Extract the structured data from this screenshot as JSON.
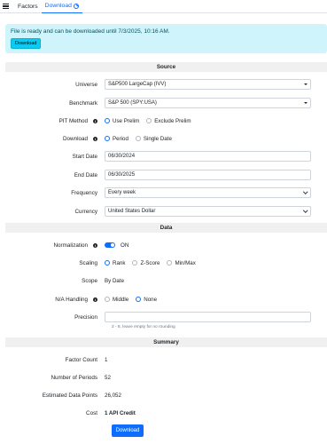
{
  "tabs": [
    {
      "label": "Factors"
    },
    {
      "label": "Download"
    }
  ],
  "alert": {
    "message": "File is ready and can be downloaded until 7/3/2025, 10:16 AM.",
    "button": "Download"
  },
  "sections": {
    "source": "Source",
    "data": "Data",
    "summary": "Summary"
  },
  "source": {
    "universe": {
      "label": "Universe",
      "value": "S&P500 LargeCap (IVV)"
    },
    "benchmark": {
      "label": "Benchmark",
      "value": "S&P 500 (SPY:USA)"
    },
    "pit_method": {
      "label": "PIT Method",
      "options": [
        "Use Prelim",
        "Exclude Prelim"
      ],
      "selected": "Use Prelim"
    },
    "download": {
      "label": "Download",
      "options": [
        "Period",
        "Single Date"
      ],
      "selected": "Period"
    },
    "start_date": {
      "label": "Start Date",
      "value": "06/30/2024"
    },
    "end_date": {
      "label": "End Date",
      "value": "06/30/2025"
    },
    "frequency": {
      "label": "Frequency",
      "value": "Every week"
    },
    "currency": {
      "label": "Currency",
      "value": "United States Dollar"
    }
  },
  "data": {
    "normalization": {
      "label": "Normalization",
      "value": "ON"
    },
    "scaling": {
      "label": "Scaling",
      "options": [
        "Rank",
        "Z-Score",
        "Min/Max"
      ],
      "selected": "Rank"
    },
    "scope": {
      "label": "Scope",
      "value": "By Date"
    },
    "na_handling": {
      "label": "N/A Handling",
      "options": [
        "Middle",
        "None"
      ],
      "selected": "None"
    },
    "precision": {
      "label": "Precision",
      "value": "",
      "hint": "2 - 8, leave empty for no rounding"
    }
  },
  "summary": {
    "factor_count": {
      "label": "Factor Count",
      "value": "1"
    },
    "periods": {
      "label": "Number of Periods",
      "value": "52"
    },
    "data_points": {
      "label": "Estimated Data Points",
      "value": "26,052"
    },
    "cost": {
      "label": "Cost",
      "value": "1 API Credit"
    },
    "button": "Download"
  },
  "colors": {
    "primary": "#0d6efd",
    "alert_bg": "#cff4fc",
    "info_btn": "#0dcaf0"
  }
}
